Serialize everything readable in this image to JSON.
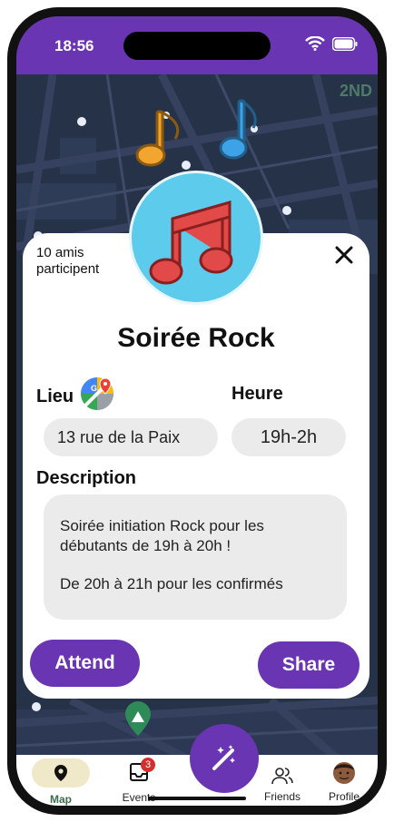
{
  "status": {
    "time": "18:56"
  },
  "event": {
    "friends_note": "10 amis participent",
    "title": "Soirée Rock",
    "location_label": "Lieu",
    "location_value": "13 rue de la Paix",
    "time_label": "Heure",
    "time_value": "19h-2h",
    "description_label": "Description",
    "description_line1": "Soirée initiation Rock pour les",
    "description_line2": "débutants de 19h à 20h !",
    "description_line3": "De 20h à 21h pour les confirmés",
    "attend_label": "Attend",
    "share_label": "Share"
  },
  "map": {
    "corner_text": "2ND"
  },
  "tabs": {
    "map": "Map",
    "events": "Events",
    "events_badge": "3",
    "friends": "Friends",
    "profile": "Profile"
  },
  "colors": {
    "accent": "#6a35b3",
    "map_bg": "#263248",
    "pill_bg": "#ebebeb"
  },
  "icons": [
    "wifi-icon",
    "battery-icon",
    "map-pin-icon",
    "inbox-icon",
    "people-icon",
    "avatar",
    "magic-wand-icon",
    "google-maps-icon",
    "close-icon",
    "music-notes-icon"
  ]
}
